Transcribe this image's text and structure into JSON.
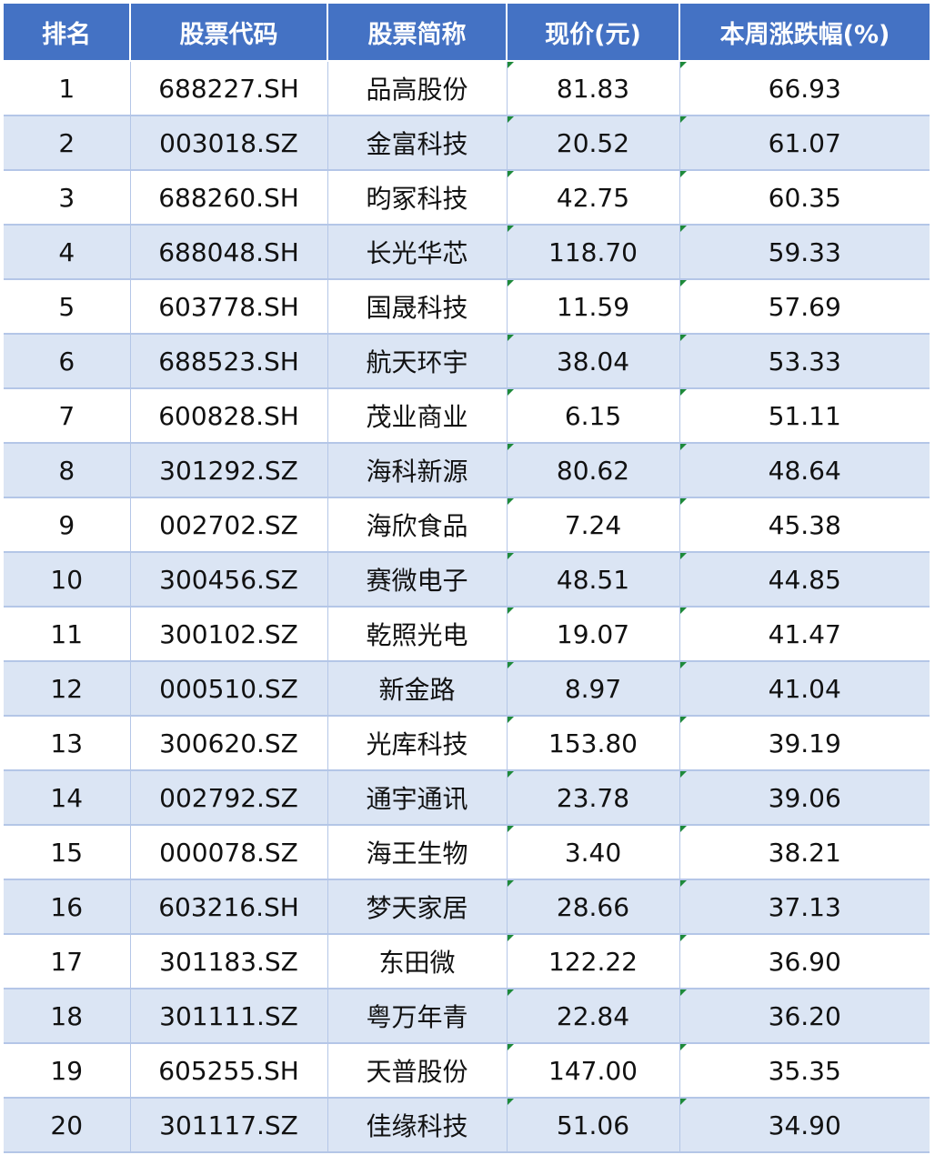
{
  "table": {
    "headers": [
      "排名",
      "股票代码",
      "股票简称",
      "现价(元)",
      "本周涨跌幅(%)"
    ],
    "rows": [
      [
        "1",
        "688227.SH",
        "品高股份",
        "81.83",
        "66.93"
      ],
      [
        "2",
        "003018.SZ",
        "金富科技",
        "20.52",
        "61.07"
      ],
      [
        "3",
        "688260.SH",
        "昀冢科技",
        "42.75",
        "60.35"
      ],
      [
        "4",
        "688048.SH",
        "长光华芯",
        "118.70",
        "59.33"
      ],
      [
        "5",
        "603778.SH",
        "国晟科技",
        "11.59",
        "57.69"
      ],
      [
        "6",
        "688523.SH",
        "航天环宇",
        "38.04",
        "53.33"
      ],
      [
        "7",
        "600828.SH",
        "茂业商业",
        "6.15",
        "51.11"
      ],
      [
        "8",
        "301292.SZ",
        "海科新源",
        "80.62",
        "48.64"
      ],
      [
        "9",
        "002702.SZ",
        "海欣食品",
        "7.24",
        "45.38"
      ],
      [
        "10",
        "300456.SZ",
        "赛微电子",
        "48.51",
        "44.85"
      ],
      [
        "11",
        "300102.SZ",
        "乾照光电",
        "19.07",
        "41.47"
      ],
      [
        "12",
        "000510.SZ",
        "新金路",
        "8.97",
        "41.04"
      ],
      [
        "13",
        "300620.SZ",
        "光库科技",
        "153.80",
        "39.19"
      ],
      [
        "14",
        "002792.SZ",
        "通宇通讯",
        "23.78",
        "39.06"
      ],
      [
        "15",
        "000078.SZ",
        "海王生物",
        "3.40",
        "38.21"
      ],
      [
        "16",
        "603216.SH",
        "梦天家居",
        "28.66",
        "37.13"
      ],
      [
        "17",
        "301183.SZ",
        "东田微",
        "122.22",
        "36.90"
      ],
      [
        "18",
        "301111.SZ",
        "粤万年青",
        "22.84",
        "36.20"
      ],
      [
        "19",
        "605255.SH",
        "天普股份",
        "147.00",
        "35.35"
      ],
      [
        "20",
        "301117.SZ",
        "佳缘科技",
        "51.06",
        "34.90"
      ]
    ]
  },
  "colors": {
    "header_bg": "#4472C4",
    "header_text": "#ffffff",
    "stripe_row": "#dbe5f4",
    "gridline": "#b4c6e7",
    "cell_flag": "#1e8a3a"
  }
}
